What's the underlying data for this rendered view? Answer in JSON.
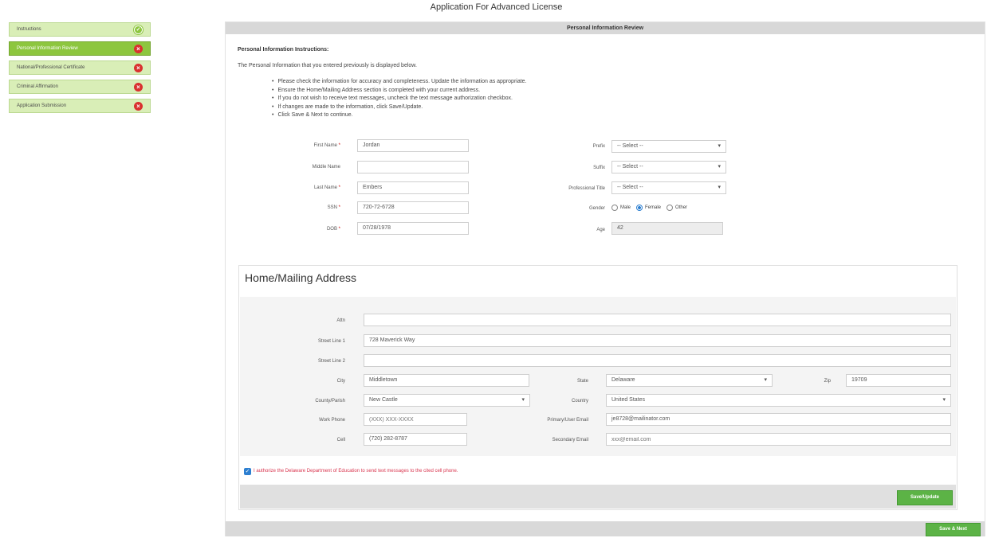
{
  "page_title": "Application For Advanced License",
  "sidebar": {
    "items": [
      {
        "label": "Instructions",
        "status": "complete",
        "active": false
      },
      {
        "label": "Personal Information Review",
        "status": "incomplete",
        "active": true
      },
      {
        "label": "National/Professional Certificate",
        "status": "incomplete",
        "active": false
      },
      {
        "label": "Criminal Affirmation",
        "status": "incomplete",
        "active": false
      },
      {
        "label": "Application Submission",
        "status": "incomplete",
        "active": false
      }
    ],
    "status_icons": {
      "complete": "check-icon",
      "incomplete": "x-icon"
    }
  },
  "section": {
    "header": "Personal Information Review",
    "instructions_title": "Personal Information Instructions:",
    "instructions_text": "The Personal Information that you entered previously is displayed below.",
    "bullets": [
      "Please check the information for accuracy and completeness. Update the information as appropriate.",
      "Ensure the Home/Mailing Address section is completed with your current address.",
      "If you do not wish to receive text messages, uncheck the text message authorization checkbox.",
      "If changes are made to the information, click Save/Update.",
      "Click Save & Next to continue."
    ]
  },
  "personal": {
    "first_name": {
      "label": "First Name",
      "value": "Jordan"
    },
    "middle_name": {
      "label": "Middle Name",
      "value": ""
    },
    "last_name": {
      "label": "Last Name",
      "value": "Embers"
    },
    "ssn": {
      "label": "SSN",
      "value": "720-72-6728"
    },
    "dob": {
      "label": "DOB",
      "value": "07/28/1978"
    },
    "prefix": {
      "label": "Prefix",
      "value": "-- Select --"
    },
    "suffix": {
      "label": "Suffix",
      "value": "-- Select --"
    },
    "professional_title": {
      "label": "Professional Title",
      "value": "-- Select --"
    },
    "gender": {
      "label": "Gender",
      "options": [
        "Male",
        "Female",
        "Other"
      ],
      "selected": "Female"
    },
    "age": {
      "label": "Age",
      "value": "42"
    },
    "required_mark": "*"
  },
  "address": {
    "legend": "Home/Mailing Address",
    "attn": {
      "label": "Attn",
      "value": ""
    },
    "street1": {
      "label": "Street Line 1",
      "value": "728 Maverick Way"
    },
    "street2": {
      "label": "Street Line 2",
      "value": ""
    },
    "city": {
      "label": "City",
      "value": "Middletown"
    },
    "state": {
      "label": "State",
      "value": "Delaware"
    },
    "zip": {
      "label": "Zip",
      "value": "19709"
    },
    "county": {
      "label": "County/Parish",
      "value": "New Castle"
    },
    "country": {
      "label": "Country",
      "value": "United States"
    },
    "work_phone": {
      "label": "Work Phone",
      "placeholder": "(XXX) XXX-XXXX"
    },
    "primary_email": {
      "label": "Primary/User Email",
      "value": "je8728@mailinator.com"
    },
    "cell": {
      "label": "Cell",
      "value": "(720) 282-8787"
    },
    "secondary_email": {
      "label": "Secondary Email",
      "placeholder": "xxx@email.com"
    },
    "sms_consent": {
      "label": "I authorize the Delaware Department of Education to send text messages to the cited cell phone.",
      "checked": true
    },
    "save_update_label": "Save/Update"
  },
  "footer": {
    "save_next_label": "Save & Next"
  },
  "colors": {
    "accent_green": "#8dc63f",
    "button_green": "#5cb346",
    "error_red": "#d9312f",
    "consent_text": "#d9364f"
  }
}
